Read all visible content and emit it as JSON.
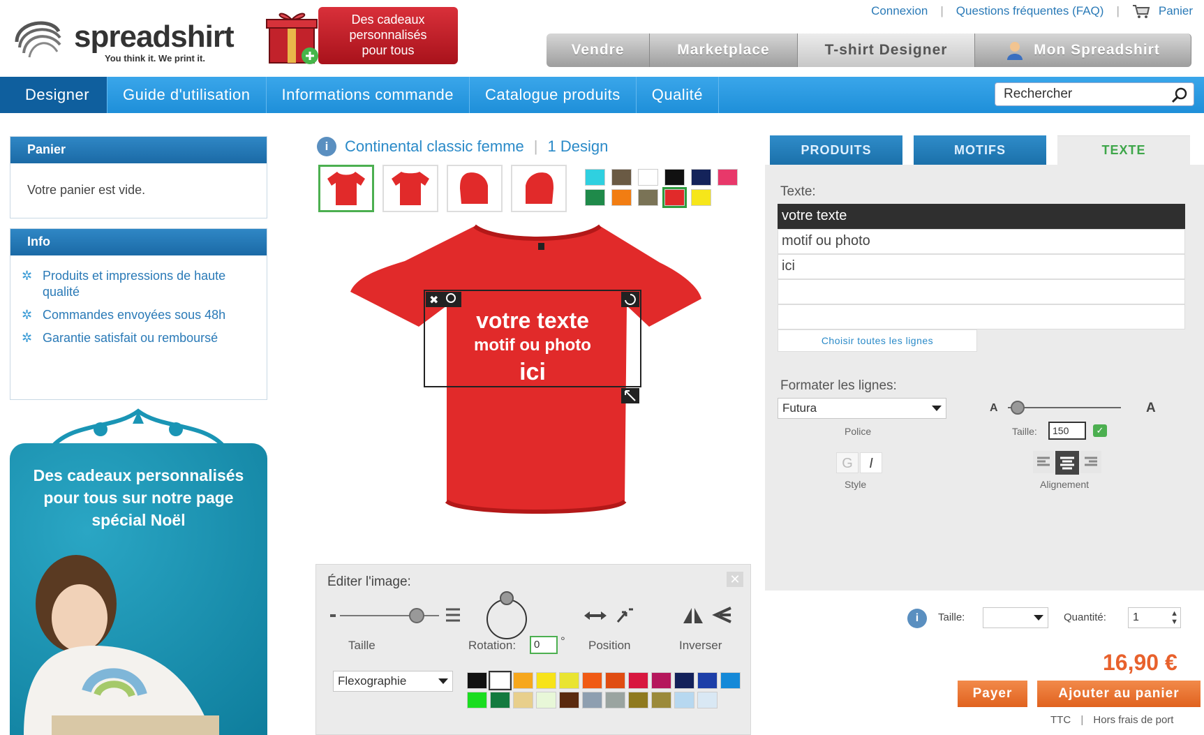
{
  "header": {
    "brand": "spreadshirt",
    "tagline": "You think it. We print it.",
    "promo_text": "Des cadeaux\npersonnalisés\npour tous",
    "top_links": [
      "Connexion",
      "Questions fréquentes (FAQ)",
      "Panier"
    ],
    "tabs": [
      "Vendre",
      "Marketplace",
      "T-shirt Designer",
      "Mon Spreadshirt"
    ]
  },
  "nav": {
    "items": [
      "Designer",
      "Guide d'utilisation",
      "Informations commande",
      "Catalogue produits",
      "Qualité"
    ],
    "search_placeholder": "Rechercher"
  },
  "sidebar": {
    "cart_title": "Panier",
    "cart_empty": "Votre panier est vide.",
    "info_title": "Info",
    "info_items": [
      "Produits et impressions de haute qualité",
      "Commandes envoyées sous 48h",
      "Garantie satisfait ou remboursé"
    ],
    "promo_text": "Des cadeaux personnalisés\npour tous sur notre page\nspécial Noël"
  },
  "product": {
    "name": "Continental classic femme",
    "design_count": "1 Design",
    "colors": [
      "#2fd0e0",
      "#6a5a44",
      "#ffffff",
      "#111111",
      "#14235a",
      "#e8386a",
      "#1f8a4a",
      "#f27d12",
      "#7a7356",
      "#e12a2a",
      "#f6e61a"
    ],
    "selected_color": "#e12a2a",
    "shirt_text": [
      "votre texte",
      "motif ou photo",
      "ici"
    ]
  },
  "edit_image": {
    "title": "Éditer l'image:",
    "size_label": "Taille",
    "rotation_label": "Rotation:",
    "rotation_value": "0",
    "rotation_unit": "°",
    "position_label": "Position",
    "invert_label": "Inverser",
    "print_method": "Flexographie",
    "palette": [
      "#111111",
      "#ffffff",
      "#f6a71d",
      "#f7e31a",
      "#e9e431",
      "#f05a14",
      "#e04d12",
      "#d8173f",
      "#b5175c",
      "#13215a",
      "#1d3fa8",
      "#1589d8",
      "#1bdd20",
      "#137a3e",
      "#e8cf8c",
      "#e8f7d8",
      "#5a2a0e",
      "#8e9fb0",
      "#9aa4a0",
      "#8f7a1f",
      "#9b8a3a",
      "#b7d8f0",
      "#d9e8f4"
    ]
  },
  "text_tool": {
    "tabs": [
      "PRODUITS",
      "MOTIFS",
      "TEXTE"
    ],
    "text_label": "Texte:",
    "lines": [
      "votre texte",
      "motif ou photo",
      "ici",
      "",
      ""
    ],
    "select_all": "Choisir toutes les lignes",
    "format_label": "Formater les lignes:",
    "font": "Futura",
    "font_label": "Police",
    "size_label": "Taille:",
    "size_value": "150",
    "small_a": "A",
    "large_a": "A",
    "bold": "G",
    "italic": "I",
    "style_label": "Style",
    "align_label": "Alignement"
  },
  "order": {
    "size_label": "Taille:",
    "qty_label": "Quantité:",
    "qty_value": "1",
    "price": "16,90 €",
    "pay_button": "Payer",
    "add_button": "Ajouter au panier",
    "tax_note": "TTC",
    "shipping_note": "Hors frais de port"
  }
}
